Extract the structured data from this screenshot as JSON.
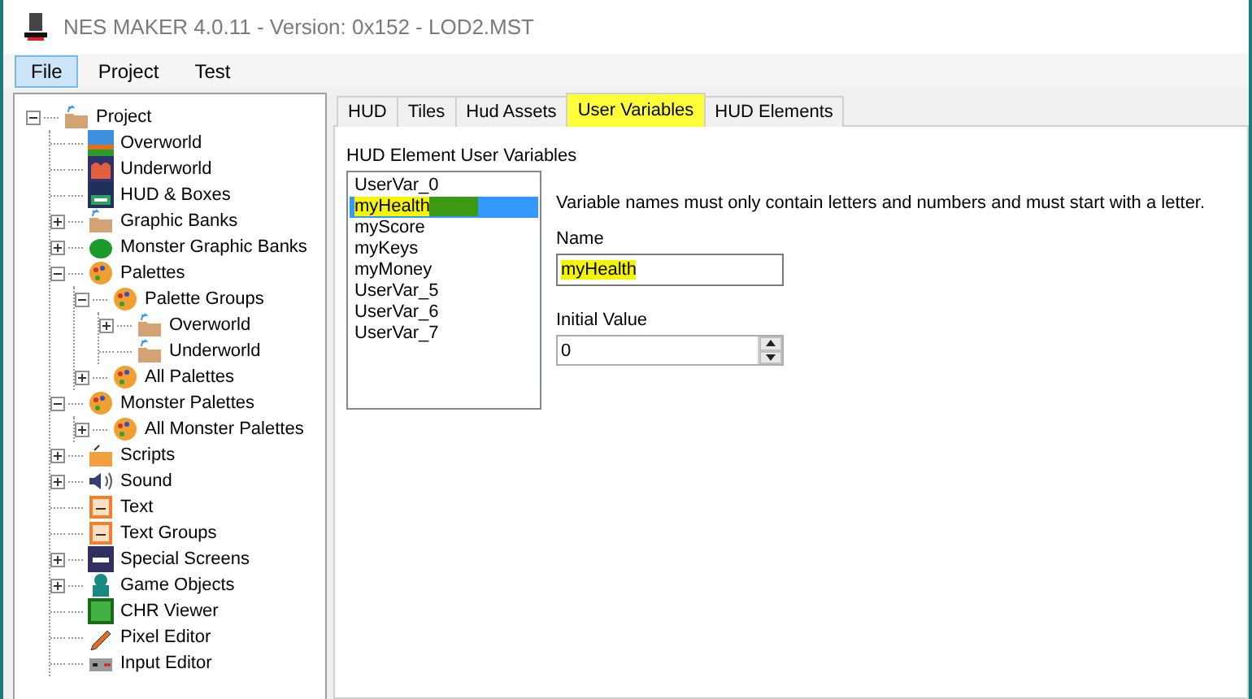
{
  "window": {
    "title": "NES MAKER 4.0.11 - Version: 0x152 - LOD2.MST"
  },
  "menu": [
    {
      "label": "File",
      "selected": true
    },
    {
      "label": "Project",
      "selected": false
    },
    {
      "label": "Test",
      "selected": false
    }
  ],
  "tree": [
    {
      "label": "Project",
      "kind": "folder",
      "expanded": true,
      "children": [
        {
          "label": "Overworld",
          "kind": "map"
        },
        {
          "label": "Underworld",
          "kind": "cave"
        },
        {
          "label": "HUD & Boxes",
          "kind": "hud"
        },
        {
          "label": "Graphic Banks",
          "kind": "folder",
          "expanded": false
        },
        {
          "label": "Monster Graphic Banks",
          "kind": "blob",
          "expanded": false
        },
        {
          "label": "Palettes",
          "kind": "palette",
          "expanded": true,
          "children": [
            {
              "label": "Palette Groups",
              "kind": "palette",
              "expanded": true,
              "children": [
                {
                  "label": "Overworld",
                  "kind": "folder",
                  "expanded": false
                },
                {
                  "label": "Underworld",
                  "kind": "folder"
                }
              ]
            },
            {
              "label": "All Palettes",
              "kind": "palette",
              "expanded": false
            }
          ]
        },
        {
          "label": "Monster Palettes",
          "kind": "palette",
          "expanded": true,
          "children": [
            {
              "label": "All Monster Palettes",
              "kind": "palette",
              "expanded": false
            }
          ]
        },
        {
          "label": "Scripts",
          "kind": "script",
          "expanded": false
        },
        {
          "label": "Sound",
          "kind": "sound",
          "expanded": false
        },
        {
          "label": "Text",
          "kind": "note"
        },
        {
          "label": "Text Groups",
          "kind": "note"
        },
        {
          "label": "Special Screens",
          "kind": "screen",
          "expanded": false
        },
        {
          "label": "Game Objects",
          "kind": "character",
          "expanded": false
        },
        {
          "label": "CHR Viewer",
          "kind": "chr"
        },
        {
          "label": "Pixel Editor",
          "kind": "pencil"
        },
        {
          "label": "Input Editor",
          "kind": "controller"
        }
      ]
    }
  ],
  "tabs": [
    {
      "label": "HUD",
      "selected": false,
      "highlighted": false
    },
    {
      "label": "Tiles",
      "selected": false,
      "highlighted": false
    },
    {
      "label": "Hud Assets",
      "selected": false,
      "highlighted": false
    },
    {
      "label": "User Variables",
      "selected": true,
      "highlighted": true
    },
    {
      "label": "HUD Elements",
      "selected": false,
      "highlighted": false
    }
  ],
  "variables": {
    "label": "HUD Element User Variables",
    "items": [
      {
        "label": "UserVar_0",
        "selected": false,
        "highlighted": false
      },
      {
        "label": "myHealth",
        "selected": true,
        "highlighted": true
      },
      {
        "label": "myScore",
        "selected": false,
        "highlighted": false
      },
      {
        "label": "myKeys",
        "selected": false,
        "highlighted": false
      },
      {
        "label": "myMoney",
        "selected": false,
        "highlighted": false
      },
      {
        "label": "UserVar_5",
        "selected": false,
        "highlighted": false
      },
      {
        "label": "UserVar_6",
        "selected": false,
        "highlighted": false
      },
      {
        "label": "UserVar_7",
        "selected": false,
        "highlighted": false
      }
    ]
  },
  "hint": "Variable names must only contain letters and numbers and must start with a letter.",
  "name_field": {
    "label": "Name",
    "value": "myHealth",
    "highlighted": true
  },
  "initial_value": {
    "label": "Initial Value",
    "value": "0"
  }
}
